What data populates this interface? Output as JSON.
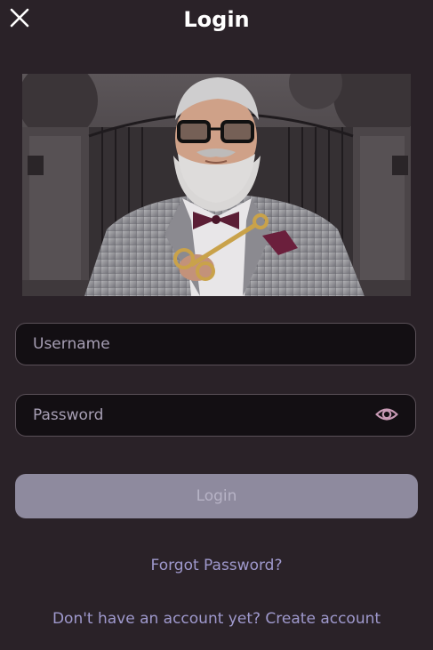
{
  "header": {
    "title": "Login",
    "close_icon": "close-icon"
  },
  "hero": {
    "image_icon": "hero-illustration"
  },
  "form": {
    "username_placeholder": "Username",
    "username_value": "",
    "password_placeholder": "Password",
    "password_value": "",
    "eye_icon": "eye-icon",
    "login_label": "Login"
  },
  "links": {
    "forgot_password": "Forgot Password?",
    "signup_prompt": "Don't have an account yet?",
    "signup_action": "Create account"
  },
  "colors": {
    "background": "#2a2228",
    "field_background": "#130f13",
    "button_disabled": "#8e8a9e",
    "link": "#9f99cd",
    "eye_icon": "#c89ab5"
  }
}
